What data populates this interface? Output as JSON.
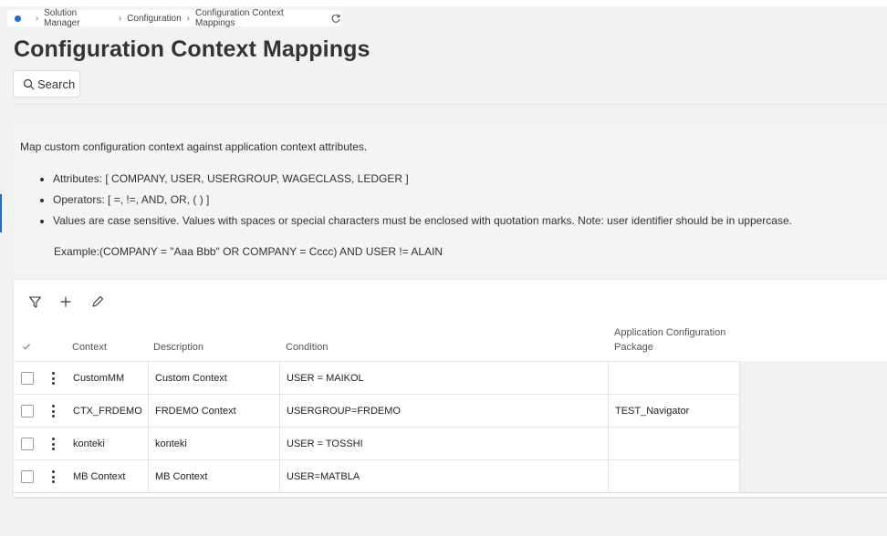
{
  "breadcrumb": {
    "items": [
      "Solution Manager",
      "Configuration",
      "Configuration Context Mappings"
    ]
  },
  "page": {
    "title": "Configuration Context Mappings",
    "search_label": "Search"
  },
  "info": {
    "intro": "Map custom configuration context against application context attributes.",
    "bullets": [
      "Attributes: [ COMPANY, USER, USERGROUP, WAGECLASS, LEDGER ]",
      "Operators: [ =, !=, AND, OR, ( ) ]",
      "Values are case sensitive. Values with spaces or special characters must be enclosed with quotation marks. Note: user identifier should be in uppercase."
    ],
    "example": "Example:(COMPANY = \"Aaa Bbb\" OR COMPANY = Cccc) AND USER != ALAIN"
  },
  "table": {
    "headers": {
      "context": "Context",
      "description": "Description",
      "condition": "Condition",
      "package": "Application Configuration Package"
    },
    "rows": [
      {
        "context": "CustomMM",
        "description": "Custom Context",
        "condition": "USER = MAIKOL",
        "package": ""
      },
      {
        "context": "CTX_FRDEMO",
        "description": "FRDEMO Context",
        "condition": "USERGROUP=FRDEMO",
        "package": "TEST_Navigator"
      },
      {
        "context": "konteki",
        "description": "konteki",
        "condition": "USER = TOSSHI",
        "package": ""
      },
      {
        "context": "MB Context",
        "description": "MB Context",
        "condition": "USER=MATBLA",
        "package": ""
      }
    ]
  },
  "colors": {
    "accent": "#1b6fd1",
    "background": "#f2f2f2"
  }
}
